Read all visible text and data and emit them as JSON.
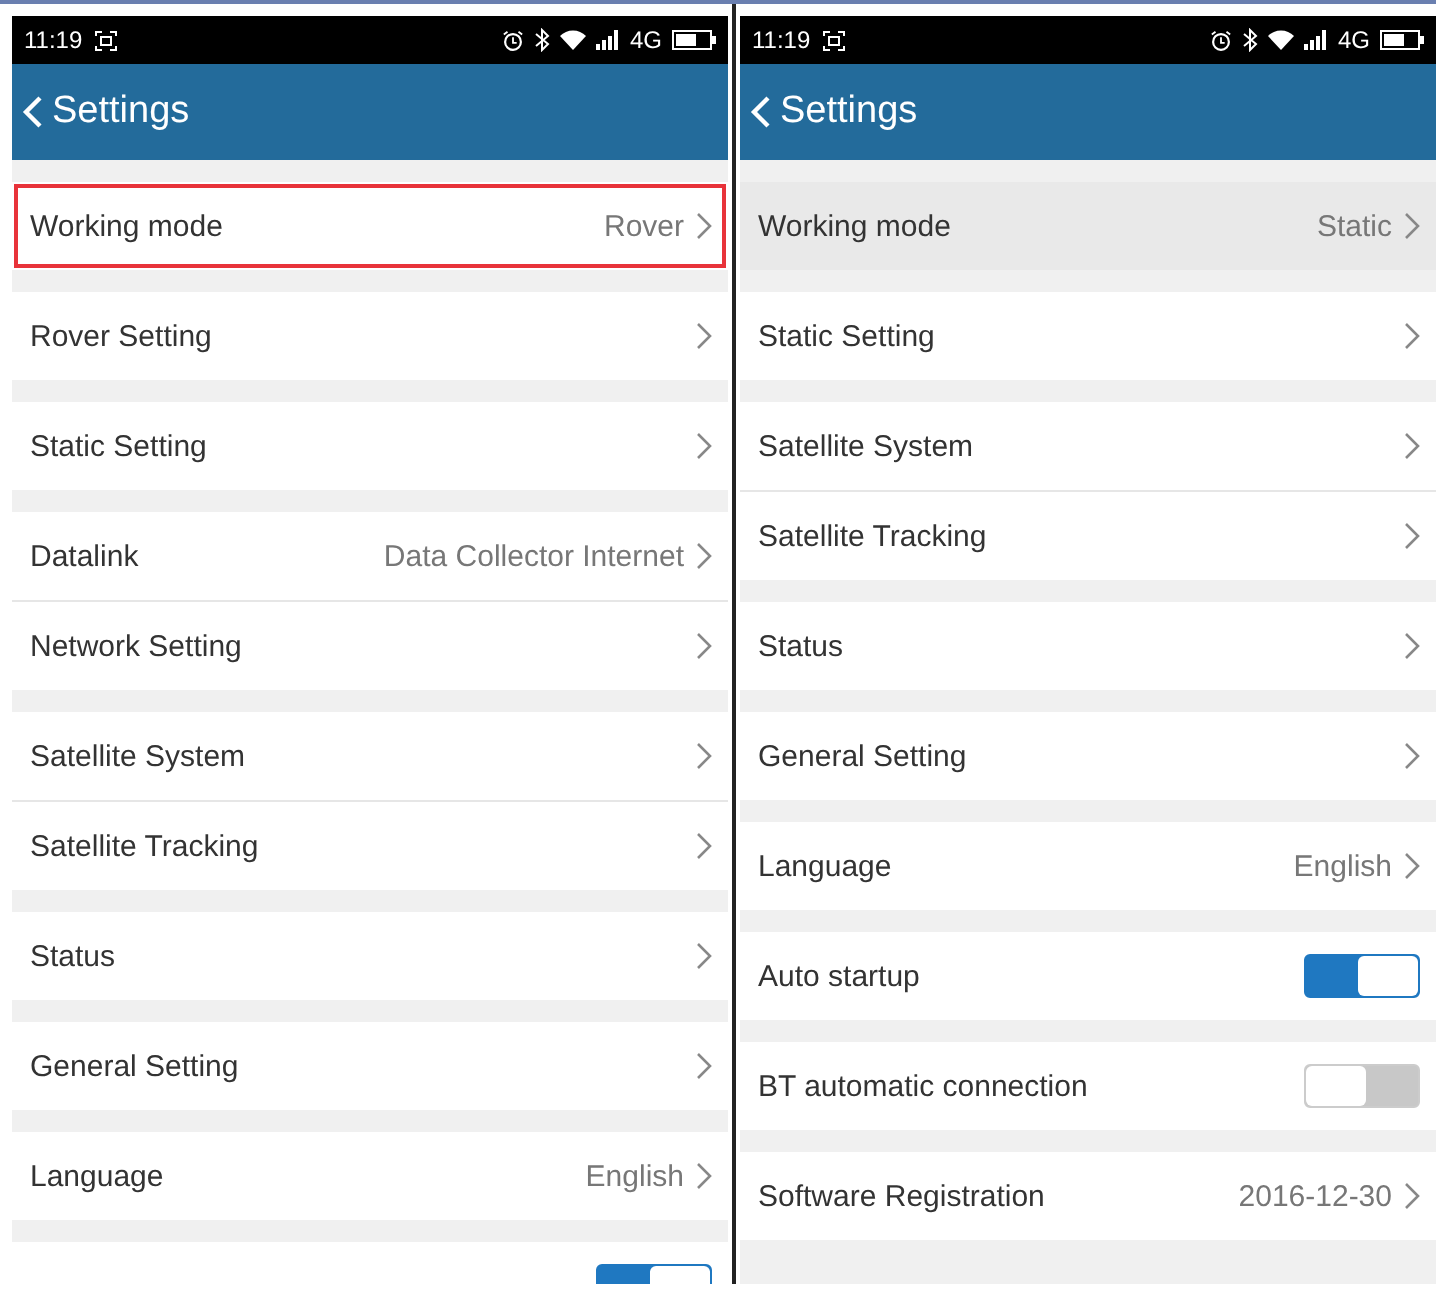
{
  "screens": [
    {
      "status_bar": {
        "time": "11:19",
        "network": "4G"
      },
      "header": {
        "title": "Settings"
      },
      "groups": [
        [
          {
            "kind": "link",
            "label": "Working mode",
            "value": "Rover",
            "selected": false,
            "outlined": true
          }
        ],
        [
          {
            "kind": "link",
            "label": "Rover Setting",
            "selected": false
          }
        ],
        [
          {
            "kind": "link",
            "label": "Static Setting",
            "selected": false
          }
        ],
        [
          {
            "kind": "link",
            "label": "Datalink",
            "value": "Data Collector Internet",
            "selected": false
          },
          {
            "kind": "link",
            "label": "Network Setting",
            "selected": false
          }
        ],
        [
          {
            "kind": "link",
            "label": "Satellite System",
            "selected": false
          },
          {
            "kind": "link",
            "label": "Satellite Tracking",
            "selected": false
          }
        ],
        [
          {
            "kind": "link",
            "label": "Status",
            "selected": false
          }
        ],
        [
          {
            "kind": "link",
            "label": "General Setting",
            "selected": false
          }
        ],
        [
          {
            "kind": "link",
            "label": "Language",
            "value": "English",
            "selected": false
          }
        ],
        [
          {
            "kind": "toggle",
            "on": true,
            "selected": false
          }
        ]
      ]
    },
    {
      "status_bar": {
        "time": "11:19",
        "network": "4G"
      },
      "header": {
        "title": "Settings"
      },
      "groups": [
        [
          {
            "kind": "link",
            "label": "Working mode",
            "value": "Static",
            "selected": true
          }
        ],
        [
          {
            "kind": "link",
            "label": "Static Setting",
            "selected": false
          }
        ],
        [
          {
            "kind": "link",
            "label": "Satellite System",
            "selected": false
          },
          {
            "kind": "link",
            "label": "Satellite Tracking",
            "selected": false
          }
        ],
        [
          {
            "kind": "link",
            "label": "Status",
            "selected": false
          }
        ],
        [
          {
            "kind": "link",
            "label": "General Setting",
            "selected": false
          }
        ],
        [
          {
            "kind": "link",
            "label": "Language",
            "value": "English",
            "selected": false
          }
        ],
        [
          {
            "kind": "toggle",
            "label": "Auto startup",
            "on": true,
            "selected": false
          }
        ],
        [
          {
            "kind": "toggle",
            "label": "BT automatic connection",
            "on": false,
            "selected": false
          }
        ],
        [
          {
            "kind": "link",
            "label": "Software Registration",
            "value": "2016-12-30",
            "selected": false
          }
        ]
      ]
    }
  ]
}
